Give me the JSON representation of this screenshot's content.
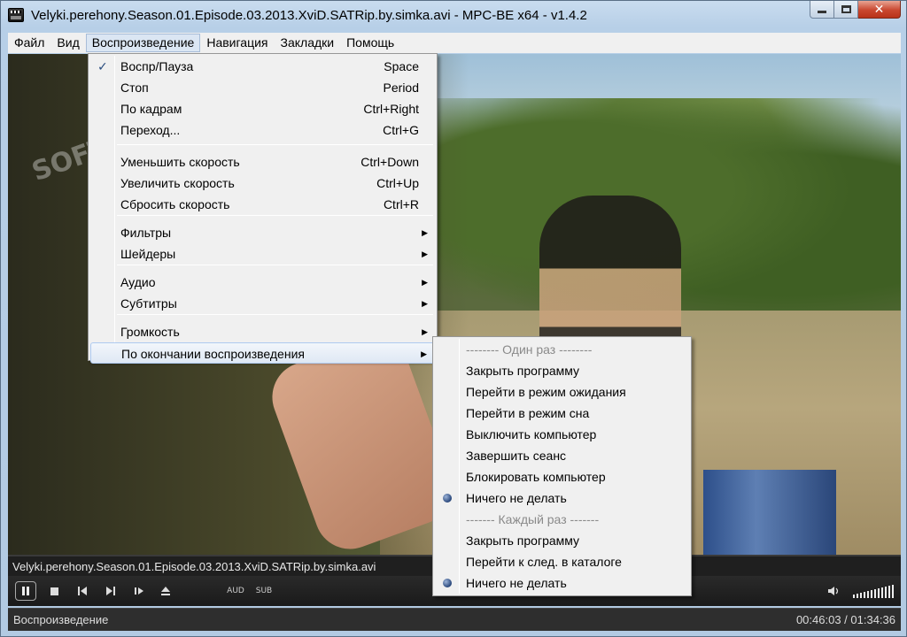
{
  "window": {
    "title": "Velyki.perehony.Season.01.Episode.03.2013.XviD.SATRip.by.simka.avi - MPC-BE x64 - v1.4.2",
    "buttons": {
      "minimize": "minimize",
      "maximize": "maximize",
      "close": "✕"
    }
  },
  "menubar": [
    {
      "label": "Файл"
    },
    {
      "label": "Вид"
    },
    {
      "label": "Воспроизведение",
      "active": true
    },
    {
      "label": "Навигация"
    },
    {
      "label": "Закладки"
    },
    {
      "label": "Помощь"
    }
  ],
  "watermark": "SOFTPORTAL",
  "playback_menu": {
    "items": [
      {
        "label": "Воспр/Пауза",
        "shortcut": "Space",
        "checked": true
      },
      {
        "label": "Стоп",
        "shortcut": "Period"
      },
      {
        "label": "По кадрам",
        "shortcut": "Ctrl+Right"
      },
      {
        "label": "Переход...",
        "shortcut": "Ctrl+G"
      },
      {
        "label": "Уменьшить скорость",
        "shortcut": "Ctrl+Down"
      },
      {
        "label": "Увеличить скорость",
        "shortcut": "Ctrl+Up"
      },
      {
        "label": "Сбросить скорость",
        "shortcut": "Ctrl+R"
      },
      {
        "label": "Фильтры",
        "submenu": true
      },
      {
        "label": "Шейдеры",
        "submenu": true
      },
      {
        "label": "Аудио",
        "submenu": true
      },
      {
        "label": "Субтитры",
        "submenu": true
      },
      {
        "label": "Громкость",
        "submenu": true
      },
      {
        "label": "По окончании воспроизведения",
        "submenu": true,
        "highlighted": true
      }
    ],
    "check_glyph": "✓",
    "arrow_glyph": "▶"
  },
  "after_playback_submenu": {
    "items": [
      {
        "label": "-------- Один раз --------",
        "header": true
      },
      {
        "label": "Закрыть программу"
      },
      {
        "label": "Перейти в режим ожидания"
      },
      {
        "label": "Перейти в режим сна"
      },
      {
        "label": "Выключить компьютер"
      },
      {
        "label": "Завершить сеанс"
      },
      {
        "label": "Блокировать компьютер"
      },
      {
        "label": "Ничего не делать",
        "selected": true
      },
      {
        "label": "------- Каждый раз -------",
        "header": true
      },
      {
        "label": "Закрыть программу"
      },
      {
        "label": "Перейти к след. в каталоге"
      },
      {
        "label": "Ничего не делать",
        "selected": true
      }
    ]
  },
  "player": {
    "filename": "Velyki.perehony.Season.01.Episode.03.2013.XviD.SATRip.by.simka.avi",
    "buttons": {
      "aud": "AUD",
      "sub": "SUB"
    },
    "volume_level": 1.0
  },
  "statusbar": {
    "state": "Воспроизведение",
    "time": "00:46:03 / 01:34:36"
  },
  "colors": {
    "menu_bg": "#f0f0f0",
    "highlight_border": "#aecaf0",
    "player_bg": "#1f1f1f"
  }
}
